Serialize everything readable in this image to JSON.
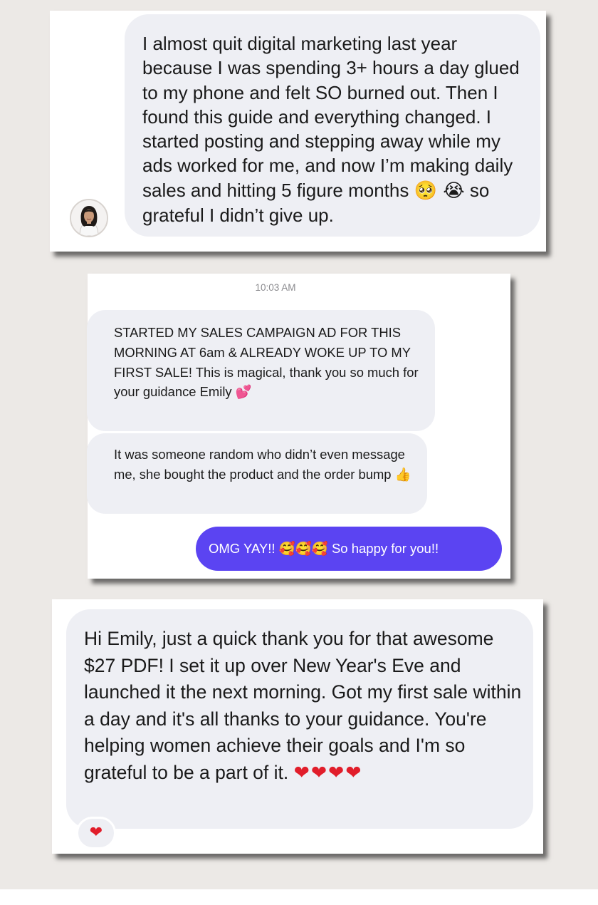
{
  "testimonial_1": {
    "message_text": "I almost quit digital marketing last year because I was spending 3+ hours a day glued to my phone and felt SO burned out. Then I found this guide and everything changed. I started posting and stepping away while my ads worked for me, and now I’m making daily sales and hitting 5 figure months",
    "emojis": "🥺 😭",
    "message_end": "so grateful I didn’t give up."
  },
  "testimonial_2": {
    "timestamp": "10:03 AM",
    "message_1_text": "STARTED MY SALES CAMPAIGN AD FOR THIS MORNING AT 6am & ALREADY WOKE UP TO MY FIRST SALE! This is magical, thank you so much for your guidance Emily",
    "message_1_emoji": "💕",
    "message_2_text": "It was someone random who didn’t even message me, she bought the product and the order bump",
    "message_2_emoji": "👍",
    "reply_text": "OMG YAY!!",
    "reply_emojis": "🥰🥰🥰",
    "reply_end": "So happy for you!!"
  },
  "testimonial_3": {
    "message_text": "Hi Emily, just a quick thank you for that awesome $27 PDF! I set it up over New Year's Eve and launched it the next morning. Got my first sale within a day and it's all thanks to your guidance. You're helping women achieve their goals and I'm so grateful to be a part of it.",
    "hearts": "❤❤❤❤",
    "reaction": "❤"
  },
  "colors": {
    "page_background": "#ece9e6",
    "incoming_bubble": "#eeeff4",
    "outgoing_bubble": "#5b44f2",
    "heart": "#e11d2a"
  }
}
